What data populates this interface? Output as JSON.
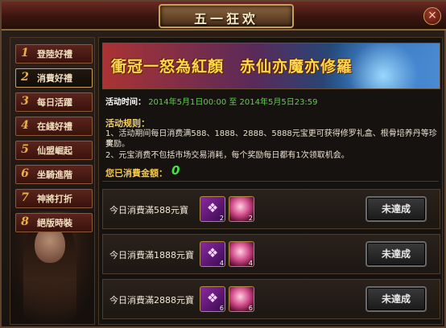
{
  "window": {
    "title": "五一狂欢",
    "close_label": "×"
  },
  "sidebar": {
    "items": [
      {
        "num": "1",
        "label": "登陸好禮"
      },
      {
        "num": "2",
        "label": "消費好禮"
      },
      {
        "num": "3",
        "label": "每日活躍"
      },
      {
        "num": "4",
        "label": "在綫好禮"
      },
      {
        "num": "5",
        "label": "仙盟崛起"
      },
      {
        "num": "6",
        "label": "坐騎進階"
      },
      {
        "num": "7",
        "label": "神將打折"
      },
      {
        "num": "8",
        "label": "絕版時裝"
      }
    ],
    "active_index": 1
  },
  "banner": {
    "text": "衝冠一怒為紅顏　赤仙亦魔亦修羅"
  },
  "activity": {
    "time_label": "活动时间：",
    "time_value": "2014年5月1日00:00 至 2014年5月5日23:59"
  },
  "rules": {
    "title": "活动规则：",
    "line1": "1、活动期间每日消费满588、1888、2888、5888元宝更可获得修罗礼盒、根骨培养丹等珍贵",
    "line1b": "奖励。",
    "line2": "2、元宝消费不包括市场交易消耗，每个奖励每日都有1次领取机会。"
  },
  "consumed": {
    "label": "您已消費金額：",
    "value": "0"
  },
  "rewards": [
    {
      "label": "今日消費滿588元寶",
      "box_count": "2",
      "orb_count": "2",
      "button": "未達成"
    },
    {
      "label": "今日消費滿1888元寶",
      "box_count": "4",
      "orb_count": "4",
      "button": "未達成"
    },
    {
      "label": "今日消費滿2888元寶",
      "box_count": "6",
      "orb_count": "6",
      "button": "未達成"
    }
  ],
  "icons": {
    "box": "gift-box-icon",
    "orb": "pill-orb-icon"
  }
}
